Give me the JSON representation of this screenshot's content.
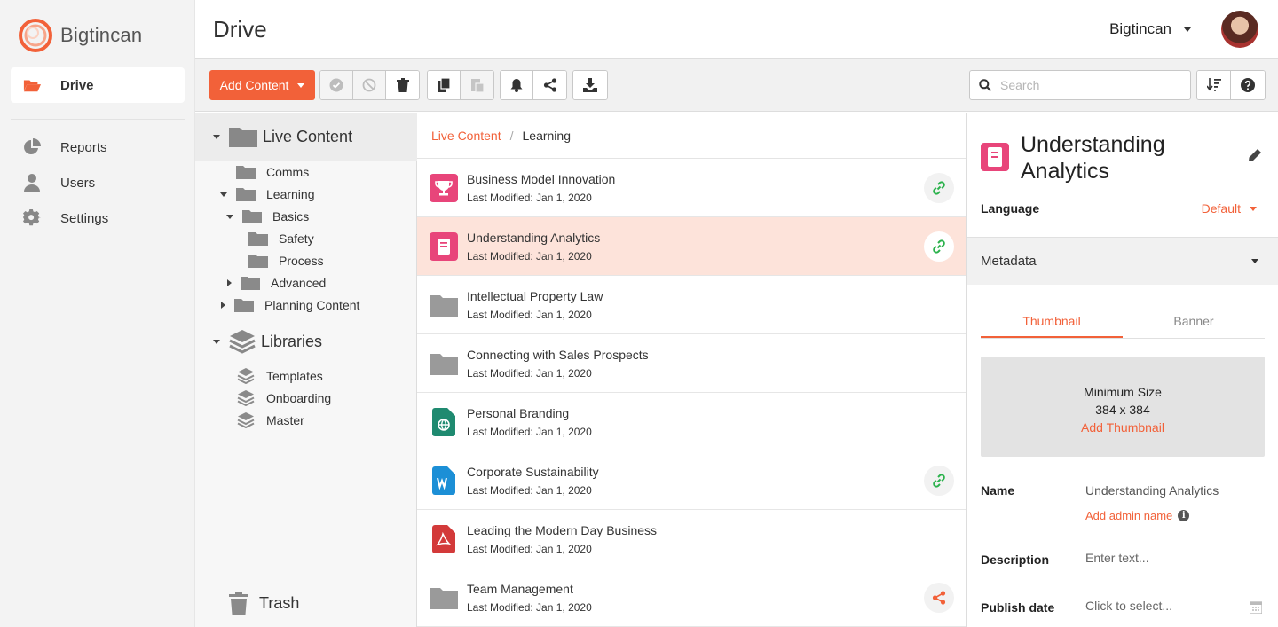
{
  "brand": {
    "name": "Bigtincan",
    "accent": "#f26139"
  },
  "leftnav": {
    "items": [
      {
        "label": "Drive",
        "icon": "folder-open-icon",
        "active": true
      },
      {
        "label": "Reports",
        "icon": "pie-chart-icon"
      },
      {
        "label": "Users",
        "icon": "user-icon"
      },
      {
        "label": "Settings",
        "icon": "gear-icon"
      }
    ]
  },
  "header": {
    "title": "Drive",
    "account": "Bigtincan"
  },
  "toolbar": {
    "add_label": "Add Content",
    "search_placeholder": "Search",
    "icons": [
      "check-circle-icon",
      "ban-icon",
      "trash-icon",
      "copy-icon",
      "paste-icon",
      "bell-icon",
      "share-icon",
      "download-icon",
      "sort-icon",
      "help-icon"
    ]
  },
  "tree": {
    "live_root": "Live Content",
    "live_items": [
      {
        "label": "Comms",
        "expander": "none",
        "level": 1
      },
      {
        "label": "Learning",
        "expander": "down",
        "level": 1
      },
      {
        "label": "Basics",
        "expander": "down",
        "level": 2
      },
      {
        "label": "Safety",
        "expander": "none",
        "level": 3
      },
      {
        "label": "Process",
        "expander": "none",
        "level": 3
      },
      {
        "label": "Advanced",
        "expander": "right",
        "level": 2
      },
      {
        "label": "Planning Content",
        "expander": "right",
        "level": 1
      }
    ],
    "libs_root": "Libraries",
    "lib_items": [
      "Templates",
      "Onboarding",
      "Master"
    ],
    "trash": "Trash"
  },
  "list": {
    "crumbs": {
      "root": "Live Content",
      "sep": "/",
      "current": "Learning"
    },
    "rows": [
      {
        "title": "Business Model Innovation",
        "meta": "Last Modified: Jan 1, 2020",
        "icon": "trophy-icon",
        "icon_color": "#e8457a",
        "action": "link-icon"
      },
      {
        "title": "Understanding Analytics",
        "meta": "Last Modified: Jan 1, 2020",
        "icon": "document-icon",
        "icon_color": "#e8457a",
        "action": "link-icon",
        "selected": true
      },
      {
        "title": "Intellectual Property Law",
        "meta": "Last Modified: Jan 1, 2020",
        "icon": "folder-icon",
        "icon_color": "#9a9a9a",
        "action": ""
      },
      {
        "title": "Connecting with Sales Prospects",
        "meta": "Last Modified: Jan 1, 2020",
        "icon": "folder-icon",
        "icon_color": "#9a9a9a",
        "action": ""
      },
      {
        "title": "Personal Branding",
        "meta": "Last Modified: Jan 1, 2020",
        "icon": "globe-file-icon",
        "icon_color": "#1f8a70",
        "action": ""
      },
      {
        "title": "Corporate Sustainability",
        "meta": "Last Modified: Jan 1, 2020",
        "icon": "word-file-icon",
        "icon_color": "#1c8fd6",
        "action": "link-icon"
      },
      {
        "title": "Leading the Modern Day Business",
        "meta": "Last Modified: Jan 1, 2020",
        "icon": "pdf-file-icon",
        "icon_color": "#d33a3a",
        "action": ""
      },
      {
        "title": "Team Management",
        "meta": "Last Modified: Jan 1, 2020",
        "icon": "folder-icon",
        "icon_color": "#9a9a9a",
        "action": "share-icon"
      }
    ]
  },
  "detail": {
    "title": "Understanding Analytics",
    "language_label": "Language",
    "language_value": "Default",
    "metadata_label": "Metadata",
    "tabs": [
      "Thumbnail",
      "Banner"
    ],
    "thumb": {
      "line1": "Minimum Size",
      "line2": "384 x 384",
      "add": "Add Thumbnail"
    },
    "name_label": "Name",
    "name_value": "Understanding Analytics",
    "add_admin_name": "Add admin name",
    "description_label": "Description",
    "description_placeholder": "Enter text...",
    "publish_label": "Publish date",
    "publish_placeholder": "Click to select..."
  }
}
